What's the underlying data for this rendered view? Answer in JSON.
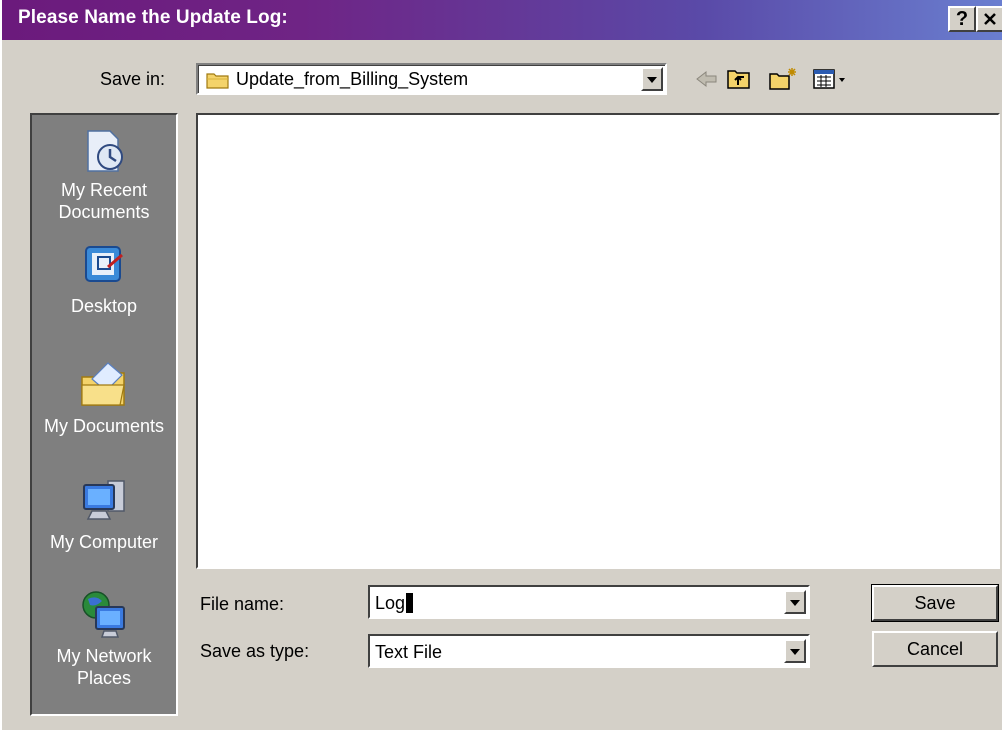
{
  "dialog": {
    "title": "Please Name the Update Log:",
    "help_button": "?",
    "close_button": "X"
  },
  "save_in": {
    "label": "Save in:",
    "value": "Update_from_Billing_System"
  },
  "places": [
    {
      "label_line1": "My Recent",
      "label_line2": "Documents",
      "icon": "recent-documents-icon"
    },
    {
      "label_line1": "Desktop",
      "label_line2": "",
      "icon": "desktop-icon"
    },
    {
      "label_line1": "My Documents",
      "label_line2": "",
      "icon": "my-documents-icon"
    },
    {
      "label_line1": "My Computer",
      "label_line2": "",
      "icon": "my-computer-icon"
    },
    {
      "label_line1": "My Network",
      "label_line2": "Places",
      "icon": "network-places-icon"
    }
  ],
  "file_name": {
    "label": "File name:",
    "value": "Log"
  },
  "save_as_type": {
    "label": "Save as type:",
    "value": "Text File"
  },
  "buttons": {
    "save": "Save",
    "cancel": "Cancel"
  },
  "colors": {
    "title_start": "#6b1a7c",
    "title_end": "#6a7fd0",
    "face": "#d4d0c8",
    "places_bg": "#7f7f7f"
  }
}
